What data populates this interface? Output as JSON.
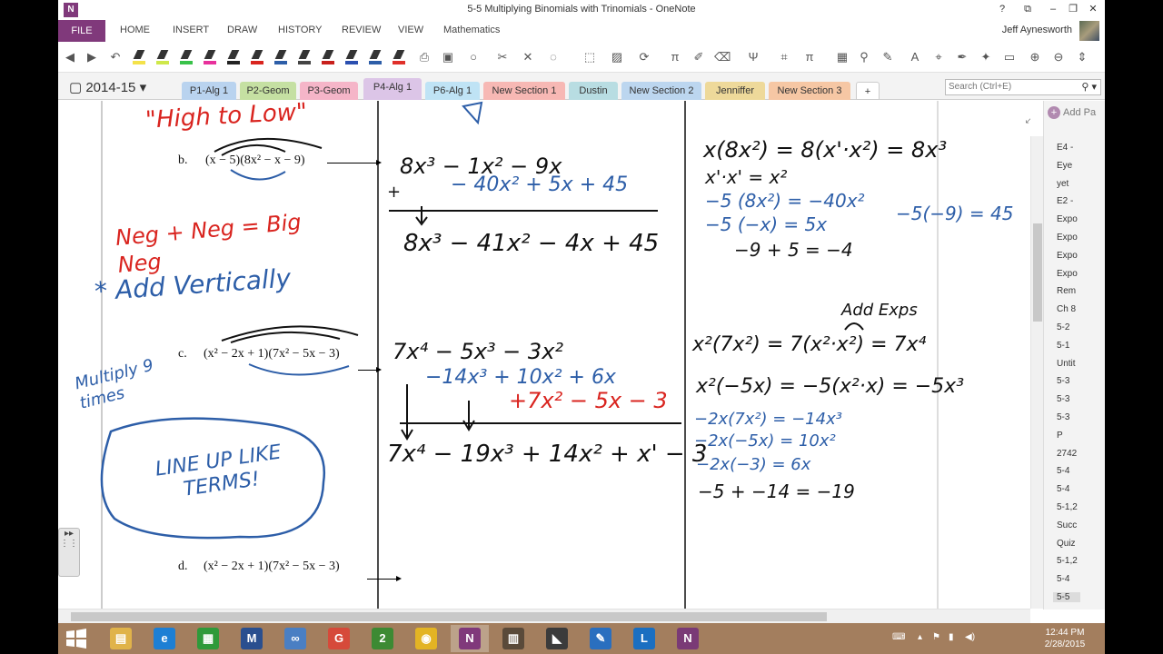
{
  "window": {
    "title": "5-5 Multiplying Binomials with Trinomials - OneNote",
    "buttons": [
      "?",
      "⧉",
      "–",
      "❐",
      "✕"
    ]
  },
  "ribbon": {
    "file": "FILE",
    "tabs": [
      "HOME",
      "INSERT",
      "DRAW",
      "HISTORY",
      "REVIEW",
      "VIEW",
      "Mathematics"
    ],
    "user": "Jeff Aynesworth"
  },
  "notebook": {
    "name": "2014-15",
    "sections": [
      {
        "label": "P1-Alg 1",
        "color": "#b9d3ef"
      },
      {
        "label": "P2-Geom",
        "color": "#c5e0a2"
      },
      {
        "label": "P3-Geom",
        "color": "#f5b5c8"
      },
      {
        "label": "P4-Alg 1",
        "color": "#dcc5e7"
      },
      {
        "label": "P6-Alg 1",
        "color": "#bfe3f5"
      },
      {
        "label": "New Section 1",
        "color": "#f7b8b4"
      },
      {
        "label": "Dustin",
        "color": "#b8dde2"
      },
      {
        "label": "New Section 2",
        "color": "#bcd6ef"
      },
      {
        "label": "Jenniffer",
        "color": "#eed99a"
      },
      {
        "label": "New Section 3",
        "color": "#f6c7a4"
      },
      {
        "label": "+",
        "color": "#ffffff"
      }
    ],
    "search_placeholder": "Search (Ctrl+E)"
  },
  "pages": {
    "add_label": "Add Pa",
    "items": [
      "E4 -",
      "Eye",
      "yet",
      "E2 -",
      "Expo",
      "Expo",
      "Expo",
      "Expo",
      "Rem",
      "Ch 8",
      "5-2",
      "5-1",
      "Untit",
      "5-3",
      "5-3",
      "5-3",
      "P",
      "2742",
      "5-4",
      "5-4",
      "5-1,2",
      "Succ",
      "Quiz",
      "5-1,2",
      "5-4",
      "5-5"
    ],
    "selected": "5-5"
  },
  "worksheet": {
    "problems": [
      {
        "label": "b.",
        "expr": "(x − 5)(8x² − x − 9)"
      },
      {
        "label": "c.",
        "expr": "(x² − 2x + 1)(7x² − 5x − 3)"
      },
      {
        "label": "d.",
        "expr": "(x² − 2x + 1)(7x² − 5x − 3)"
      }
    ]
  },
  "ink": {
    "heading_red": "\"High to Low\"",
    "neg_neg": "Neg + Neg = Big Neg",
    "add_vertically": "* Add Vertically",
    "multiply": "Multiply 9 times",
    "line_up": "LINE UP LIKE TERMS!",
    "b_work": {
      "row1": "8x³ − 1x² − 9x",
      "plus": "+",
      "row2": "− 40x² + 5x + 45",
      "result": "8x³ − 41x² − 4x + 45"
    },
    "c_work": {
      "row1": "7x⁴ − 5x³ − 3x²",
      "row2": "−14x³ + 10x² + 6x",
      "row3": "+7x² − 5x − 3",
      "result": "7x⁴ − 19x³ + 14x² + x' − 3"
    },
    "b_steps": {
      "s1": "x(8x²) = 8(x'·x²) = 8x³",
      "s2": "x'·x' = x²",
      "s3": "−5 (8x²) = −40x²",
      "s4": "−5 (−x) = 5x",
      "s5": "−9 + 5 = −4",
      "s6": "−5(−9) = 45"
    },
    "c_steps": {
      "note": "Add Exps",
      "s1": "x²(7x²) = 7(x²·x²) = 7x⁴",
      "s2": "x²(−5x) = −5(x²·x) = −5x³",
      "s3": "−2x(7x²) = −14x³",
      "s4": "−2x(−5x) = 10x²",
      "s5": "−2x(−3) = 6x",
      "s6": "−5 + −14 = −19"
    }
  },
  "colors": {
    "ink_black": "#111111",
    "ink_red": "#d9241f",
    "ink_blue": "#2d5ea8",
    "accent": "#80397b"
  },
  "taskbar": {
    "apps": [
      {
        "icon": "file-explorer-icon",
        "glyph": "▤",
        "color": "#e0b34a"
      },
      {
        "icon": "internet-explorer-icon",
        "glyph": "e",
        "color": "#1d7fd4"
      },
      {
        "icon": "store-icon",
        "glyph": "▦",
        "color": "#2f9a3a"
      },
      {
        "icon": "mathtype-icon",
        "glyph": "M",
        "color": "#2a4f8f"
      },
      {
        "icon": "geogebra-icon",
        "glyph": "∞",
        "color": "#4a7fc3"
      },
      {
        "icon": "google-icon",
        "glyph": "G",
        "color": "#d64a3a"
      },
      {
        "icon": "two-icon",
        "glyph": "2",
        "color": "#3d8a33"
      },
      {
        "icon": "chrome-icon",
        "glyph": "◉",
        "color": "#e3b424"
      },
      {
        "icon": "onenote-icon",
        "glyph": "N",
        "color": "#80397b"
      },
      {
        "icon": "book-icon",
        "glyph": "▥",
        "color": "#5a4a3a"
      },
      {
        "icon": "presentation-icon",
        "glyph": "◣",
        "color": "#3b3b3b"
      },
      {
        "icon": "notes-icon",
        "glyph": "✎",
        "color": "#2a6fbf"
      },
      {
        "icon": "lync-icon",
        "glyph": "L",
        "color": "#1b6fc1"
      },
      {
        "icon": "onenote-clip-icon",
        "glyph": "N",
        "color": "#7a3a76"
      }
    ],
    "time": "12:44 PM",
    "date": "2/28/2015"
  }
}
